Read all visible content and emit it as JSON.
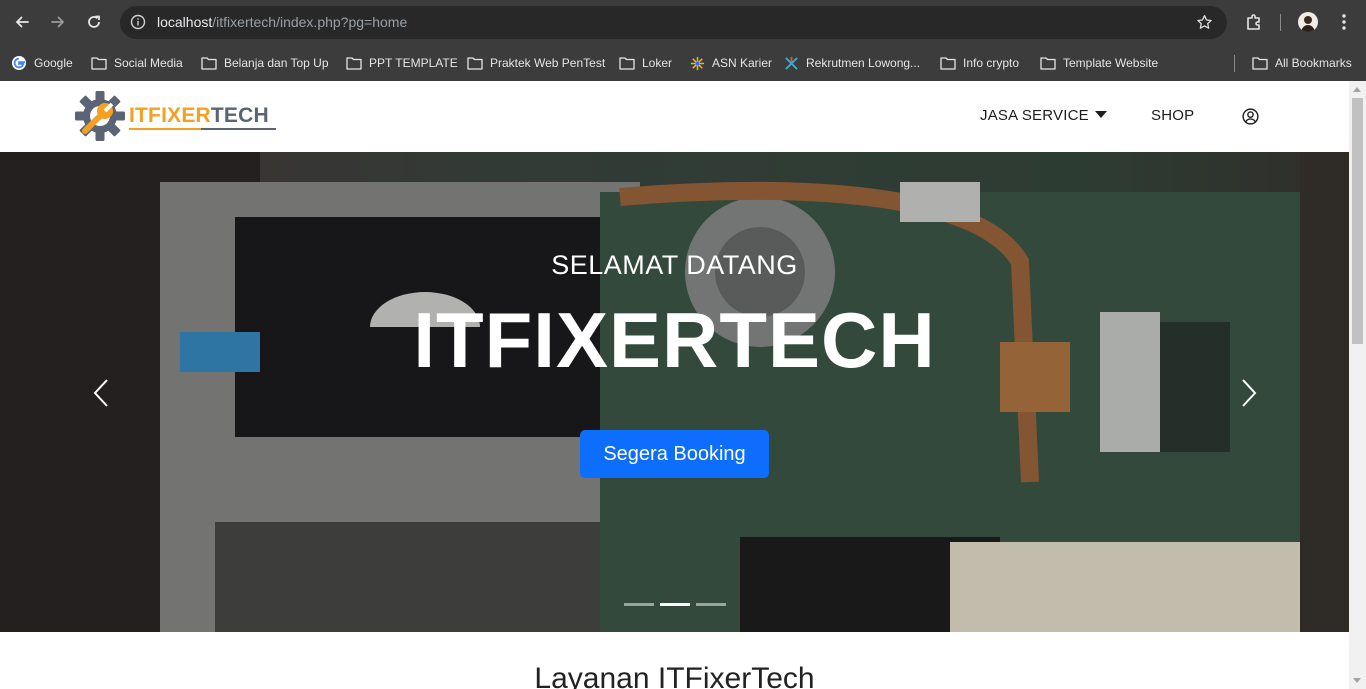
{
  "browser": {
    "url_host": "localhost",
    "url_path": "/itfixertech/index.php?pg=home",
    "bookmarks": [
      {
        "label": "Google",
        "icon": "google-icon"
      },
      {
        "label": "Social Media",
        "icon": "folder-icon"
      },
      {
        "label": "Belanja dan Top Up",
        "icon": "folder-icon"
      },
      {
        "label": "PPT TEMPLATE",
        "icon": "folder-icon"
      },
      {
        "label": "Praktek Web PenTest",
        "icon": "folder-icon"
      },
      {
        "label": "Loker",
        "icon": "folder-icon"
      },
      {
        "label": "ASN Karier",
        "icon": "asn-icon"
      },
      {
        "label": "Rekrutmen Lowong...",
        "icon": "rekrutmen-icon"
      },
      {
        "label": "Info crypto",
        "icon": "folder-icon"
      },
      {
        "label": "Template Website",
        "icon": "folder-icon"
      }
    ],
    "all_bookmarks": "All Bookmarks"
  },
  "site": {
    "logo": {
      "text_orange": "ITFIXER",
      "text_gray": "TECH"
    },
    "menu": {
      "jasa_service": "JASA SERVICE",
      "shop": "SHOP"
    }
  },
  "hero": {
    "welcome": "SELAMAT DATANG",
    "title": "ITFIXERTECH",
    "button": "Segera Booking",
    "slides": 3,
    "active_slide": 2
  },
  "section": {
    "title": "Layanan ITFixerTech"
  },
  "colors": {
    "brand_orange": "#f5a020",
    "brand_gray": "#5a6475",
    "primary_button": "#0d6efd"
  }
}
